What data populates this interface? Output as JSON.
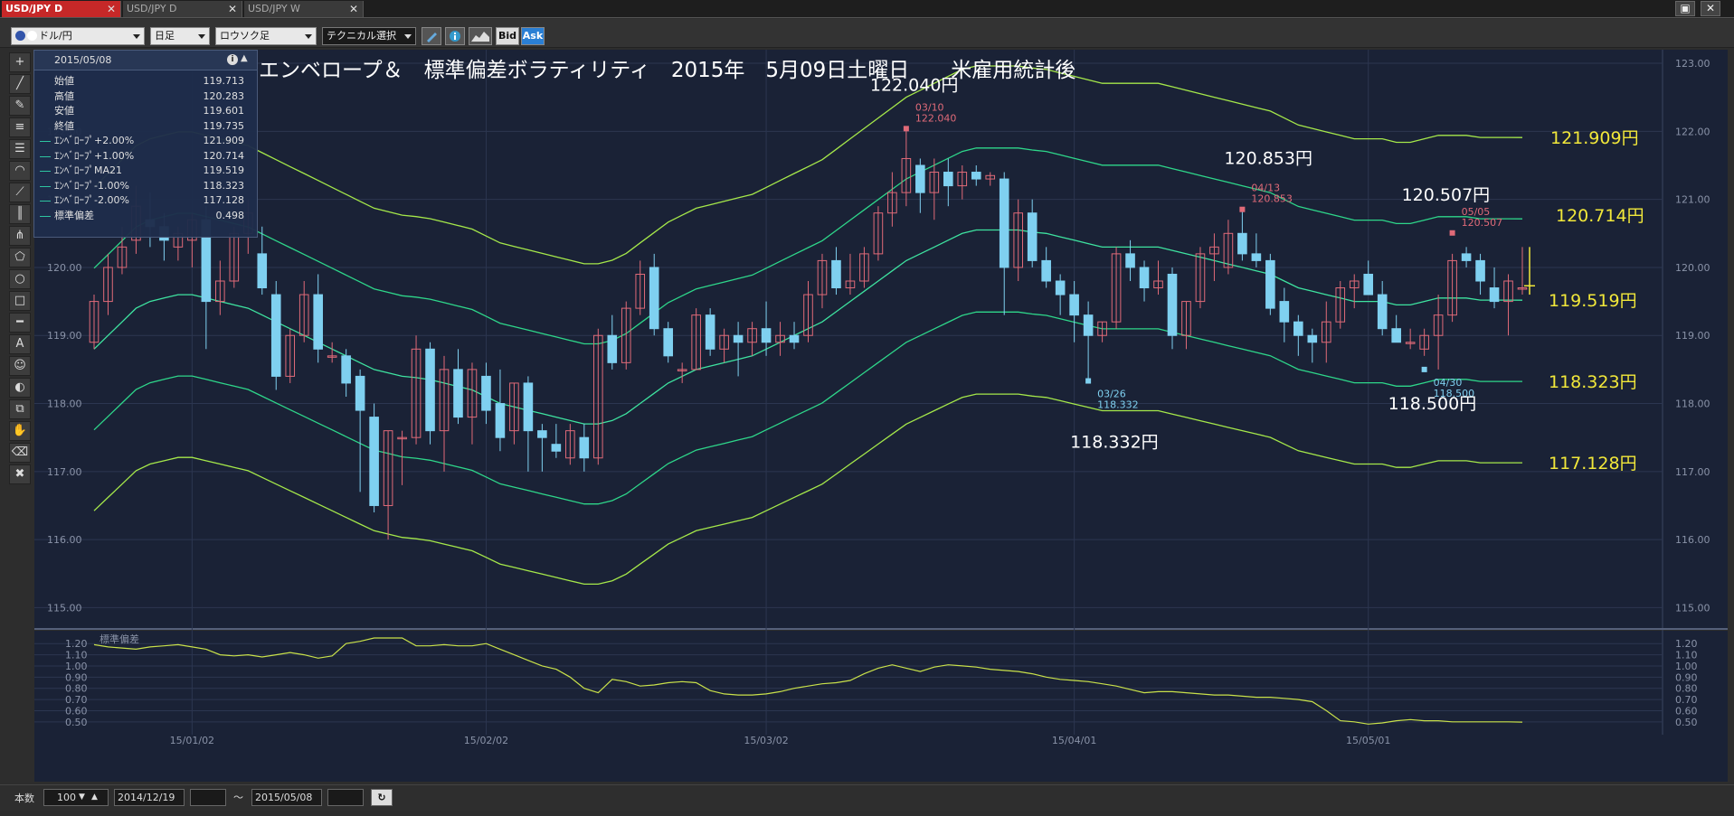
{
  "tabs": [
    {
      "label": "USD/JPY D",
      "active": true
    },
    {
      "label": "USD/JPY D",
      "active": false
    },
    {
      "label": "USD/JPY W",
      "active": false
    }
  ],
  "window_buttons": {
    "restore": "▣",
    "close": "✕"
  },
  "toolbar": {
    "symbol": "ドル/円",
    "period": "日足",
    "chart_style": "ロウソク足",
    "technical": "テクニカル選択",
    "bid": "Bid",
    "ask": "Ask"
  },
  "colors": {
    "background": "#1a2236",
    "grid": "#2c3650",
    "bull": "#e06a78",
    "bear": "#7fd0f0",
    "envelope_2": "#a5e84a",
    "envelope_1": "#2ed68a",
    "ma": "#3ee3a0",
    "callout_yellow": "#f2e83a",
    "stddev_line": "#c9e14a"
  },
  "info_panel": {
    "date": "2015/05/08",
    "rows": [
      {
        "label": "始値",
        "value": "119.713",
        "line": false
      },
      {
        "label": "高値",
        "value": "120.283",
        "line": false
      },
      {
        "label": "安値",
        "value": "119.601",
        "line": false
      },
      {
        "label": "終値",
        "value": "119.735",
        "line": false
      },
      {
        "label": "ｴﾝﾍﾞﾛｰﾌﾟ+2.00%",
        "value": "121.909",
        "line": true
      },
      {
        "label": "ｴﾝﾍﾞﾛｰﾌﾟ+1.00%",
        "value": "120.714",
        "line": true
      },
      {
        "label": "ｴﾝﾍﾞﾛｰﾌﾟMA21",
        "value": "119.519",
        "line": true
      },
      {
        "label": "ｴﾝﾍﾞﾛｰﾌﾟ-1.00%",
        "value": "118.323",
        "line": true
      },
      {
        "label": "ｴﾝﾍﾞﾛｰﾌﾟ-2.00%",
        "value": "117.128",
        "line": true
      },
      {
        "label": "標準偏差",
        "value": "0.498",
        "line": true
      }
    ]
  },
  "chart_title": "エンベロープ＆　標準偏差ボラティリティ　2015年　5月09日土曜日　　米雇用統計後",
  "chart_data": {
    "type": "candlestick",
    "price_axis": {
      "min": 114.7,
      "max": 123.2,
      "ticks": [
        115,
        116,
        117,
        118,
        119,
        120,
        121,
        122,
        123
      ],
      "tick_labels": [
        "115.00",
        "116.00",
        "117.00",
        "118.00",
        "119.00",
        "120.00",
        "121.00",
        "122.00",
        "123.00"
      ]
    },
    "date_labels": [
      {
        "label": "15/01/02",
        "index": 7
      },
      {
        "label": "15/02/02",
        "index": 28
      },
      {
        "label": "15/03/02",
        "index": 48
      },
      {
        "label": "15/04/01",
        "index": 70
      },
      {
        "label": "15/05/01",
        "index": 91
      }
    ],
    "ohlc": [
      [
        118.9,
        119.6,
        118.8,
        119.5
      ],
      [
        119.5,
        120.2,
        119.3,
        120.0
      ],
      [
        120.0,
        120.6,
        119.9,
        120.3
      ],
      [
        120.4,
        121.2,
        120.2,
        120.9
      ],
      [
        120.7,
        121.1,
        120.3,
        120.6
      ],
      [
        120.6,
        120.8,
        120.1,
        120.4
      ],
      [
        120.3,
        120.6,
        120.1,
        120.5
      ],
      [
        120.4,
        120.8,
        120.0,
        120.7
      ],
      [
        120.7,
        120.9,
        118.8,
        119.5
      ],
      [
        119.5,
        120.1,
        119.3,
        119.8
      ],
      [
        119.8,
        120.6,
        119.7,
        120.5
      ],
      [
        120.5,
        121.0,
        120.2,
        120.8
      ],
      [
        120.2,
        120.6,
        119.6,
        119.7
      ],
      [
        119.6,
        119.8,
        118.2,
        118.4
      ],
      [
        118.4,
        119.1,
        118.3,
        119.0
      ],
      [
        119.0,
        119.8,
        118.9,
        119.6
      ],
      [
        119.6,
        119.9,
        118.6,
        118.8
      ],
      [
        118.7,
        118.9,
        118.6,
        118.7
      ],
      [
        118.7,
        118.8,
        118.1,
        118.3
      ],
      [
        118.4,
        118.5,
        116.7,
        117.9
      ],
      [
        117.8,
        118.0,
        116.4,
        116.5
      ],
      [
        116.5,
        117.6,
        116.0,
        117.6
      ],
      [
        117.5,
        117.6,
        116.8,
        117.5
      ],
      [
        117.5,
        119.0,
        117.4,
        118.8
      ],
      [
        118.8,
        118.9,
        117.4,
        117.6
      ],
      [
        117.6,
        118.7,
        117.0,
        118.5
      ],
      [
        118.5,
        118.8,
        117.7,
        117.8
      ],
      [
        117.8,
        118.6,
        117.4,
        118.5
      ],
      [
        118.4,
        118.6,
        117.7,
        117.9
      ],
      [
        118.0,
        118.5,
        117.3,
        117.5
      ],
      [
        117.6,
        118.3,
        117.4,
        118.3
      ],
      [
        118.3,
        118.4,
        117.0,
        117.6
      ],
      [
        117.6,
        117.7,
        117.0,
        117.5
      ],
      [
        117.4,
        117.7,
        117.2,
        117.3
      ],
      [
        117.2,
        117.7,
        117.1,
        117.6
      ],
      [
        117.5,
        117.7,
        117.0,
        117.2
      ],
      [
        117.2,
        119.1,
        117.1,
        119.0
      ],
      [
        119.0,
        119.3,
        118.5,
        118.6
      ],
      [
        118.6,
        119.5,
        118.5,
        119.4
      ],
      [
        119.4,
        120.1,
        119.3,
        119.9
      ],
      [
        120.0,
        120.2,
        119.0,
        119.1
      ],
      [
        119.1,
        119.2,
        118.6,
        118.7
      ],
      [
        118.5,
        118.6,
        118.3,
        118.5
      ],
      [
        118.5,
        119.4,
        118.5,
        119.3
      ],
      [
        119.3,
        119.4,
        118.7,
        118.8
      ],
      [
        118.8,
        119.1,
        118.6,
        119.0
      ],
      [
        119.0,
        119.2,
        118.4,
        118.9
      ],
      [
        118.9,
        119.2,
        118.7,
        119.1
      ],
      [
        119.1,
        119.5,
        118.7,
        118.9
      ],
      [
        118.9,
        119.2,
        118.7,
        119.0
      ],
      [
        119.0,
        119.2,
        118.8,
        118.9
      ],
      [
        119.0,
        119.8,
        118.9,
        119.6
      ],
      [
        119.6,
        120.2,
        119.4,
        120.1
      ],
      [
        120.1,
        120.3,
        119.6,
        119.7
      ],
      [
        119.7,
        120.2,
        119.6,
        119.8
      ],
      [
        119.8,
        120.3,
        119.7,
        120.2
      ],
      [
        120.2,
        120.9,
        120.1,
        120.8
      ],
      [
        120.8,
        121.4,
        120.6,
        121.1
      ],
      [
        121.1,
        122.04,
        120.9,
        121.6
      ],
      [
        121.5,
        121.6,
        120.8,
        121.1
      ],
      [
        121.1,
        121.6,
        120.7,
        121.4
      ],
      [
        121.4,
        121.6,
        120.9,
        121.2
      ],
      [
        121.2,
        121.5,
        121.0,
        121.4
      ],
      [
        121.4,
        121.5,
        121.2,
        121.3
      ],
      [
        121.3,
        121.4,
        121.2,
        121.35
      ],
      [
        121.3,
        121.4,
        119.3,
        120.0
      ],
      [
        120.0,
        121.0,
        119.8,
        120.8
      ],
      [
        120.8,
        121.0,
        120.0,
        120.1
      ],
      [
        120.1,
        120.3,
        119.7,
        119.8
      ],
      [
        119.8,
        119.9,
        119.3,
        119.6
      ],
      [
        119.6,
        119.8,
        118.9,
        119.3
      ],
      [
        119.3,
        119.5,
        118.33,
        119.0
      ],
      [
        119.0,
        119.2,
        118.9,
        119.2
      ],
      [
        119.2,
        120.3,
        119.1,
        120.2
      ],
      [
        120.2,
        120.4,
        119.8,
        120.0
      ],
      [
        120.0,
        120.1,
        119.5,
        119.7
      ],
      [
        119.7,
        120.1,
        119.6,
        119.8
      ],
      [
        119.9,
        120.0,
        118.8,
        119.0
      ],
      [
        119.0,
        119.5,
        118.8,
        119.5
      ],
      [
        119.5,
        120.3,
        119.4,
        120.2
      ],
      [
        120.2,
        120.5,
        119.8,
        120.3
      ],
      [
        120.0,
        120.7,
        119.9,
        120.5
      ],
      [
        120.5,
        120.853,
        120.1,
        120.2
      ],
      [
        120.2,
        120.5,
        120.0,
        120.1
      ],
      [
        120.1,
        120.2,
        119.3,
        119.4
      ],
      [
        119.5,
        119.7,
        118.9,
        119.2
      ],
      [
        119.2,
        119.3,
        118.7,
        119.0
      ],
      [
        119.0,
        119.1,
        118.6,
        118.9
      ],
      [
        118.9,
        119.5,
        118.6,
        119.2
      ],
      [
        119.2,
        119.8,
        119.1,
        119.7
      ],
      [
        119.7,
        119.9,
        119.4,
        119.8
      ],
      [
        119.9,
        120.1,
        119.6,
        119.6
      ],
      [
        119.6,
        119.8,
        119.0,
        119.1
      ],
      [
        119.1,
        119.3,
        118.9,
        118.9
      ],
      [
        118.9,
        119.1,
        118.8,
        118.9
      ],
      [
        118.8,
        119.1,
        118.7,
        119.0
      ],
      [
        119.0,
        119.6,
        118.5,
        119.3
      ],
      [
        119.3,
        120.2,
        119.2,
        120.1
      ],
      [
        120.2,
        120.3,
        120.0,
        120.1
      ],
      [
        120.1,
        120.2,
        119.6,
        119.8
      ],
      [
        119.7,
        120.0,
        119.4,
        119.5
      ],
      [
        119.5,
        119.9,
        119.0,
        119.8
      ],
      [
        119.7,
        120.3,
        119.6,
        119.7
      ]
    ],
    "envelope_ma21": [
      118.8,
      119.0,
      119.2,
      119.4,
      119.5,
      119.55,
      119.6,
      119.6,
      119.55,
      119.5,
      119.45,
      119.4,
      119.3,
      119.2,
      119.1,
      119.0,
      118.9,
      118.8,
      118.7,
      118.6,
      118.5,
      118.45,
      118.4,
      118.38,
      118.35,
      118.3,
      118.25,
      118.2,
      118.1,
      118.0,
      117.95,
      117.9,
      117.85,
      117.8,
      117.75,
      117.7,
      117.7,
      117.75,
      117.85,
      118.0,
      118.15,
      118.3,
      118.4,
      118.5,
      118.55,
      118.6,
      118.65,
      118.7,
      118.8,
      118.9,
      119.0,
      119.1,
      119.2,
      119.35,
      119.5,
      119.65,
      119.8,
      119.95,
      120.1,
      120.2,
      120.3,
      120.4,
      120.5,
      120.55,
      120.55,
      120.55,
      120.55,
      120.52,
      120.5,
      120.45,
      120.4,
      120.35,
      120.3,
      120.3,
      120.3,
      120.3,
      120.3,
      120.25,
      120.2,
      120.15,
      120.1,
      120.05,
      120.0,
      119.95,
      119.9,
      119.8,
      119.7,
      119.65,
      119.6,
      119.55,
      119.5,
      119.5,
      119.5,
      119.45,
      119.45,
      119.5,
      119.55,
      119.55,
      119.55,
      119.52,
      119.52,
      119.52,
      119.519
    ],
    "envelope_levels_pct": [
      2,
      1,
      -1,
      -2
    ],
    "callouts": [
      {
        "label": "122.040円",
        "price": 122.04,
        "index": 58,
        "tag_date": "03/10",
        "tag_value": "122.040",
        "side": "high"
      },
      {
        "label": "120.853円",
        "price": 120.853,
        "index": 82,
        "tag_date": "04/13",
        "tag_value": "120.853",
        "side": "high"
      },
      {
        "label": "120.507円",
        "price": 120.507,
        "index": 97,
        "tag_date": "05/05",
        "tag_value": "120.507",
        "side": "high"
      },
      {
        "label": "118.332円",
        "price": 118.332,
        "index": 71,
        "tag_date": "03/26",
        "tag_value": "118.332",
        "side": "low"
      },
      {
        "label": "118.500円",
        "price": 118.5,
        "index": 95,
        "tag_date": "04/30",
        "tag_value": "118.500",
        "side": "low"
      }
    ],
    "level_callouts": [
      "121.909円",
      "120.714円",
      "119.519円",
      "118.323円",
      "117.128円"
    ],
    "stddev": {
      "label": "標準偏差",
      "axis": {
        "min": 0.45,
        "max": 1.25,
        "ticks": [
          0.5,
          0.6,
          0.7,
          0.8,
          0.9,
          1.0,
          1.1,
          1.2
        ],
        "tick_labels": [
          "0.50",
          "0.60",
          "0.70",
          "0.80",
          "0.90",
          "1.00",
          "1.10",
          "1.20"
        ]
      },
      "values": [
        1.19,
        1.17,
        1.16,
        1.15,
        1.17,
        1.18,
        1.19,
        1.17,
        1.15,
        1.1,
        1.09,
        1.1,
        1.08,
        1.1,
        1.12,
        1.1,
        1.07,
        1.09,
        1.2,
        1.22,
        1.25,
        1.25,
        1.25,
        1.18,
        1.18,
        1.19,
        1.18,
        1.18,
        1.2,
        1.15,
        1.1,
        1.05,
        1.0,
        0.97,
        0.9,
        0.8,
        0.76,
        0.88,
        0.86,
        0.82,
        0.83,
        0.85,
        0.86,
        0.85,
        0.78,
        0.75,
        0.74,
        0.74,
        0.75,
        0.77,
        0.8,
        0.82,
        0.84,
        0.85,
        0.87,
        0.93,
        0.98,
        1.01,
        0.98,
        0.95,
        0.99,
        1.01,
        1.0,
        0.99,
        0.97,
        0.96,
        0.95,
        0.93,
        0.9,
        0.88,
        0.87,
        0.86,
        0.84,
        0.82,
        0.79,
        0.76,
        0.77,
        0.77,
        0.76,
        0.75,
        0.74,
        0.74,
        0.73,
        0.72,
        0.72,
        0.71,
        0.7,
        0.68,
        0.6,
        0.51,
        0.5,
        0.48,
        0.49,
        0.51,
        0.52,
        0.51,
        0.51,
        0.5,
        0.5,
        0.5,
        0.5,
        0.5,
        0.498
      ]
    }
  },
  "bottom_bar": {
    "count_label": "本数",
    "count_value": "100",
    "date_from": "2014/12/19",
    "tilde": "～",
    "date_to": "2015/05/08",
    "refresh_icon": "↻"
  }
}
